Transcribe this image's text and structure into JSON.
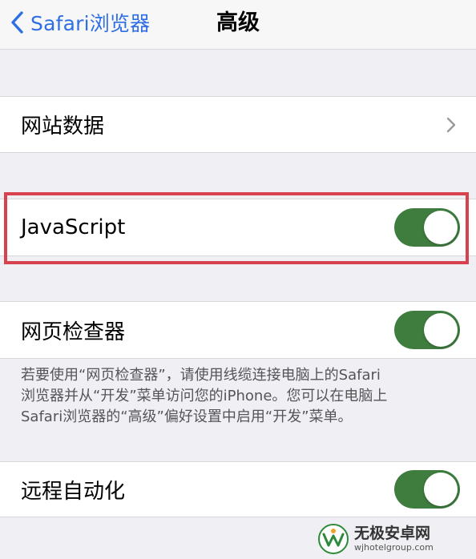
{
  "navbar": {
    "back_label": "Safari浏览器",
    "title": "高级"
  },
  "rows": {
    "website_data": {
      "label": "网站数据"
    },
    "javascript": {
      "label": "JavaScript",
      "enabled": true
    },
    "web_inspector": {
      "label": "网页检查器",
      "enabled": true
    },
    "remote_automation": {
      "label": "远程自动化",
      "enabled": true
    }
  },
  "footnote": {
    "line1": "若要使用“网页检查器”，请使用线缆连接电脑上的Safari",
    "line2": "浏览器并从“开发”菜单访问您的iPhone。您可以在电脑上",
    "line3": "Safari浏览器的“高级”偏好设置中启用“开发”菜单。"
  },
  "watermark": {
    "title": "无极安卓网",
    "url": "wjhotelgroup.com"
  },
  "colors": {
    "accent": "#2f6fe4",
    "toggle_on": "#3f7d3f",
    "highlight": "#d8414e",
    "background": "#efeff4"
  }
}
